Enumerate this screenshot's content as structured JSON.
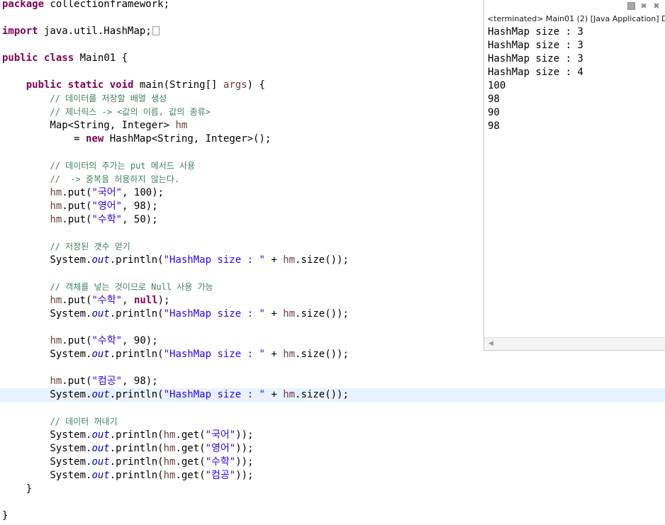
{
  "editor": {
    "lines": [
      {
        "segments": [
          {
            "t": "package",
            "c": "kw"
          },
          {
            "t": " collectionframework;"
          }
        ]
      },
      {
        "segments": []
      },
      {
        "segments": [
          {
            "t": "import",
            "c": "kw"
          },
          {
            "t": " java.util.HashMap;"
          },
          {
            "t": "",
            "c": "box"
          }
        ]
      },
      {
        "segments": []
      },
      {
        "segments": [
          {
            "t": "public",
            "c": "kw"
          },
          {
            "t": " "
          },
          {
            "t": "class",
            "c": "kw"
          },
          {
            "t": " Main01 {"
          }
        ]
      },
      {
        "segments": []
      },
      {
        "segments": [
          {
            "t": "    "
          },
          {
            "t": "public",
            "c": "kw"
          },
          {
            "t": " "
          },
          {
            "t": "static",
            "c": "kw"
          },
          {
            "t": " "
          },
          {
            "t": "void",
            "c": "kw"
          },
          {
            "t": " main(String[] "
          },
          {
            "t": "args",
            "c": "lv"
          },
          {
            "t": ") {"
          }
        ]
      },
      {
        "segments": [
          {
            "t": "        "
          },
          {
            "t": "// 데이터를 저장할 배열 생성",
            "c": "cm"
          }
        ]
      },
      {
        "segments": [
          {
            "t": "        "
          },
          {
            "t": "// 제너릭스 -> <값의 이름, 값의 종류>",
            "c": "cm"
          }
        ]
      },
      {
        "segments": [
          {
            "t": "        Map<String, Integer> "
          },
          {
            "t": "hm",
            "c": "lv"
          }
        ]
      },
      {
        "segments": [
          {
            "t": "            = "
          },
          {
            "t": "new",
            "c": "kw"
          },
          {
            "t": " HashMap<String, Integer>();"
          }
        ]
      },
      {
        "segments": []
      },
      {
        "segments": [
          {
            "t": "        "
          },
          {
            "t": "// 데이터의 추가는 put 메서드 사용",
            "c": "cm"
          }
        ]
      },
      {
        "segments": [
          {
            "t": "        "
          },
          {
            "t": "//  -> 중복을 허용하지 않는다.",
            "c": "cm"
          }
        ]
      },
      {
        "segments": [
          {
            "t": "        "
          },
          {
            "t": "hm",
            "c": "lv"
          },
          {
            "t": ".put("
          },
          {
            "t": "\"국어\"",
            "c": "st"
          },
          {
            "t": ", 100);"
          }
        ]
      },
      {
        "segments": [
          {
            "t": "        "
          },
          {
            "t": "hm",
            "c": "lv"
          },
          {
            "t": ".put("
          },
          {
            "t": "\"영어\"",
            "c": "st"
          },
          {
            "t": ", 98);"
          }
        ]
      },
      {
        "segments": [
          {
            "t": "        "
          },
          {
            "t": "hm",
            "c": "lv"
          },
          {
            "t": ".put("
          },
          {
            "t": "\"수학\"",
            "c": "st"
          },
          {
            "t": ", 50);"
          }
        ]
      },
      {
        "segments": []
      },
      {
        "segments": [
          {
            "t": "        "
          },
          {
            "t": "// 저장된 갯수 얻기",
            "c": "cm"
          }
        ]
      },
      {
        "segments": [
          {
            "t": "        System."
          },
          {
            "t": "out",
            "c": "fd"
          },
          {
            "t": ".println("
          },
          {
            "t": "\"HashMap size : \"",
            "c": "st"
          },
          {
            "t": " + "
          },
          {
            "t": "hm",
            "c": "lv"
          },
          {
            "t": ".size());"
          }
        ]
      },
      {
        "segments": []
      },
      {
        "segments": [
          {
            "t": "        "
          },
          {
            "t": "// 객체를 넣는 것이므로 Null 사용 가능",
            "c": "cm"
          }
        ]
      },
      {
        "segments": [
          {
            "t": "        "
          },
          {
            "t": "hm",
            "c": "lv"
          },
          {
            "t": ".put("
          },
          {
            "t": "\"수학\"",
            "c": "st"
          },
          {
            "t": ", "
          },
          {
            "t": "null",
            "c": "kw"
          },
          {
            "t": ");"
          }
        ]
      },
      {
        "segments": [
          {
            "t": "        System."
          },
          {
            "t": "out",
            "c": "fd"
          },
          {
            "t": ".println("
          },
          {
            "t": "\"HashMap size : \"",
            "c": "st"
          },
          {
            "t": " + "
          },
          {
            "t": "hm",
            "c": "lv"
          },
          {
            "t": ".size());"
          }
        ]
      },
      {
        "segments": []
      },
      {
        "segments": [
          {
            "t": "        "
          },
          {
            "t": "hm",
            "c": "lv"
          },
          {
            "t": ".put("
          },
          {
            "t": "\"수학\"",
            "c": "st"
          },
          {
            "t": ", 90);"
          }
        ]
      },
      {
        "segments": [
          {
            "t": "        System."
          },
          {
            "t": "out",
            "c": "fd"
          },
          {
            "t": ".println("
          },
          {
            "t": "\"HashMap size : \"",
            "c": "st"
          },
          {
            "t": " + "
          },
          {
            "t": "hm",
            "c": "lv"
          },
          {
            "t": ".size());"
          }
        ]
      },
      {
        "segments": []
      },
      {
        "segments": [
          {
            "t": "        "
          },
          {
            "t": "hm",
            "c": "lv"
          },
          {
            "t": ".put("
          },
          {
            "t": "\"컴공\"",
            "c": "st"
          },
          {
            "t": ", 98);"
          }
        ]
      },
      {
        "current": true,
        "segments": [
          {
            "t": "        System."
          },
          {
            "t": "out",
            "c": "fd"
          },
          {
            "t": ".println("
          },
          {
            "t": "\"HashMap size : \"",
            "c": "st"
          },
          {
            "t": " + "
          },
          {
            "t": "hm",
            "c": "lv"
          },
          {
            "t": ".size());"
          }
        ]
      },
      {
        "segments": []
      },
      {
        "segments": [
          {
            "t": "        "
          },
          {
            "t": "// 데이터 꺼내기",
            "c": "cm"
          }
        ]
      },
      {
        "segments": [
          {
            "t": "        System."
          },
          {
            "t": "out",
            "c": "fd"
          },
          {
            "t": ".println("
          },
          {
            "t": "hm",
            "c": "lv"
          },
          {
            "t": ".get("
          },
          {
            "t": "\"국어\"",
            "c": "st"
          },
          {
            "t": "));"
          }
        ]
      },
      {
        "segments": [
          {
            "t": "        System."
          },
          {
            "t": "out",
            "c": "fd"
          },
          {
            "t": ".println("
          },
          {
            "t": "hm",
            "c": "lv"
          },
          {
            "t": ".get("
          },
          {
            "t": "\"영어\"",
            "c": "st"
          },
          {
            "t": "));"
          }
        ]
      },
      {
        "segments": [
          {
            "t": "        System."
          },
          {
            "t": "out",
            "c": "fd"
          },
          {
            "t": ".println("
          },
          {
            "t": "hm",
            "c": "lv"
          },
          {
            "t": ".get("
          },
          {
            "t": "\"수학\"",
            "c": "st"
          },
          {
            "t": "));"
          }
        ]
      },
      {
        "segments": [
          {
            "t": "        System."
          },
          {
            "t": "out",
            "c": "fd"
          },
          {
            "t": ".println("
          },
          {
            "t": "hm",
            "c": "lv"
          },
          {
            "t": ".get("
          },
          {
            "t": "\"컴공\"",
            "c": "st"
          },
          {
            "t": "));"
          }
        ]
      },
      {
        "segments": [
          {
            "t": "    }"
          }
        ]
      },
      {
        "segments": []
      },
      {
        "segments": [
          {
            "t": "}"
          }
        ]
      }
    ]
  },
  "console": {
    "title": "<terminated> Main01 (2) [Java Application] D:",
    "toolbar_icons": [
      "terminate-icon",
      "remove-launch-icon",
      "remove-all-terminated-icon"
    ],
    "output": [
      "HashMap size : 3",
      "HashMap size : 3",
      "HashMap size : 3",
      "HashMap size : 4",
      "100",
      "98",
      "90",
      "98"
    ]
  }
}
